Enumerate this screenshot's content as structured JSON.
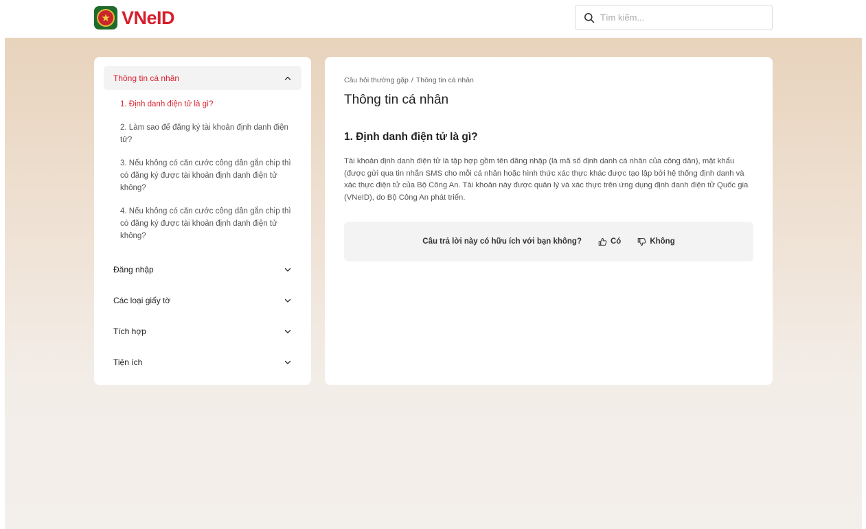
{
  "header": {
    "logo_text": "VNeID",
    "search": {
      "placeholder": "Tìm kiếm..."
    }
  },
  "sidebar": {
    "open_section": {
      "title": "Thông tin cá nhân",
      "items": [
        {
          "label": "1. Định danh điện tử là gì?",
          "active": true
        },
        {
          "label": "2. Làm sao để đăng ký tài khoản định danh điện tử?"
        },
        {
          "label": "3. Nếu không có căn cước công dân gắn chip thì có đăng ký được tài khoản định danh điện tử không?"
        },
        {
          "label": "4. Nếu không có căn cước công dân gắn chip thì có đăng ký được tài khoản định danh điện tử không?"
        }
      ]
    },
    "closed_sections": [
      {
        "title": "Đăng nhập"
      },
      {
        "title": "Các loại giấy tờ"
      },
      {
        "title": "Tích hợp"
      },
      {
        "title": "Tiện ích"
      }
    ]
  },
  "content": {
    "breadcrumb": {
      "root": "Câu hỏi thường gặp",
      "separator": "/",
      "current": "Thông tin cá nhân"
    },
    "page_title": "Thông tin cá nhân",
    "question_title": "1. Định danh điện tử là gì?",
    "answer": "Tài khoản định danh điện tử là tập hợp gồm tên đăng nhập (là mã số định danh cá nhân của công dân), mật khẩu (được gửi qua tin nhắn SMS cho mỗi cá nhân hoặc hình thức xác thực khác được tạo lập bởi hệ thống định danh và xác thực điện tử của Bộ Công An. Tài khoản này được quản lý và xác thực trên ứng dụng định danh điện tử Quốc gia (VNeID), do Bộ Công An phát triển.",
    "feedback": {
      "question": "Câu trả lời này có hữu ích với bạn không?",
      "yes_label": "Có",
      "no_label": "Không"
    }
  },
  "colors": {
    "brand_red": "#d81e2c",
    "background_top": "#e8d3bc",
    "background_bottom": "#f3efeb"
  }
}
